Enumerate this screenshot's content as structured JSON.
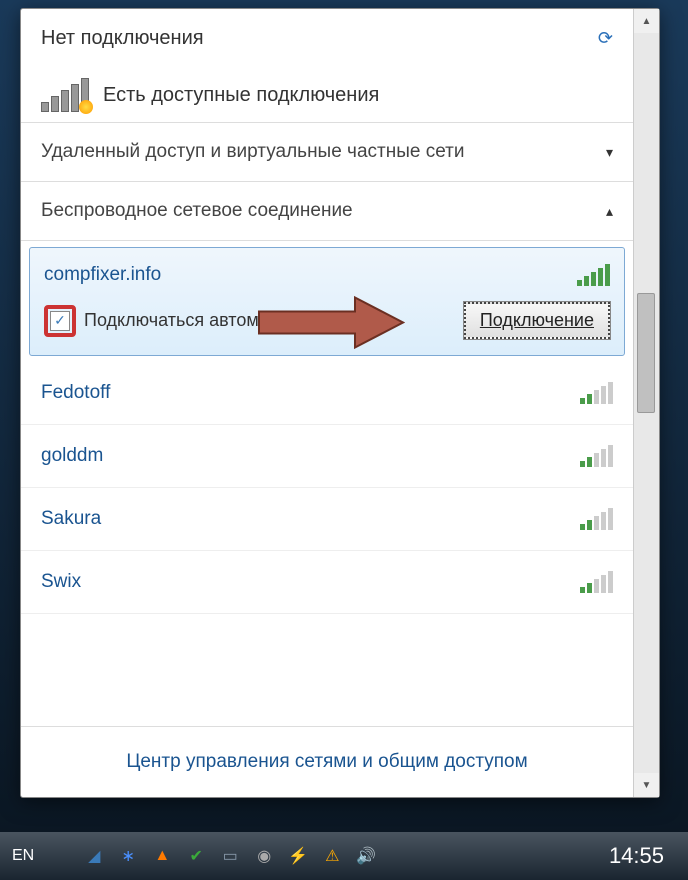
{
  "popup": {
    "header_title": "Нет подключения",
    "status_text": "Есть доступные подключения",
    "section_vpn": "Удаленный доступ и виртуальные частные сети",
    "section_wireless": "Беспроводное сетевое соединение",
    "selected": {
      "name": "compfixer.info",
      "auto_connect_label": "Подключаться автоматически",
      "connect_button": "Подключение"
    },
    "networks": [
      {
        "name": "Fedotoff"
      },
      {
        "name": "golddm"
      },
      {
        "name": "Sakura"
      },
      {
        "name": "Swix"
      }
    ],
    "footer_link": "Центр управления сетями и общим доступом"
  },
  "taskbar": {
    "language": "EN",
    "clock": "14:55"
  },
  "annotation": {
    "arrow_color": "#b05a4a",
    "checkbox_highlight_color": "#cc3333"
  }
}
